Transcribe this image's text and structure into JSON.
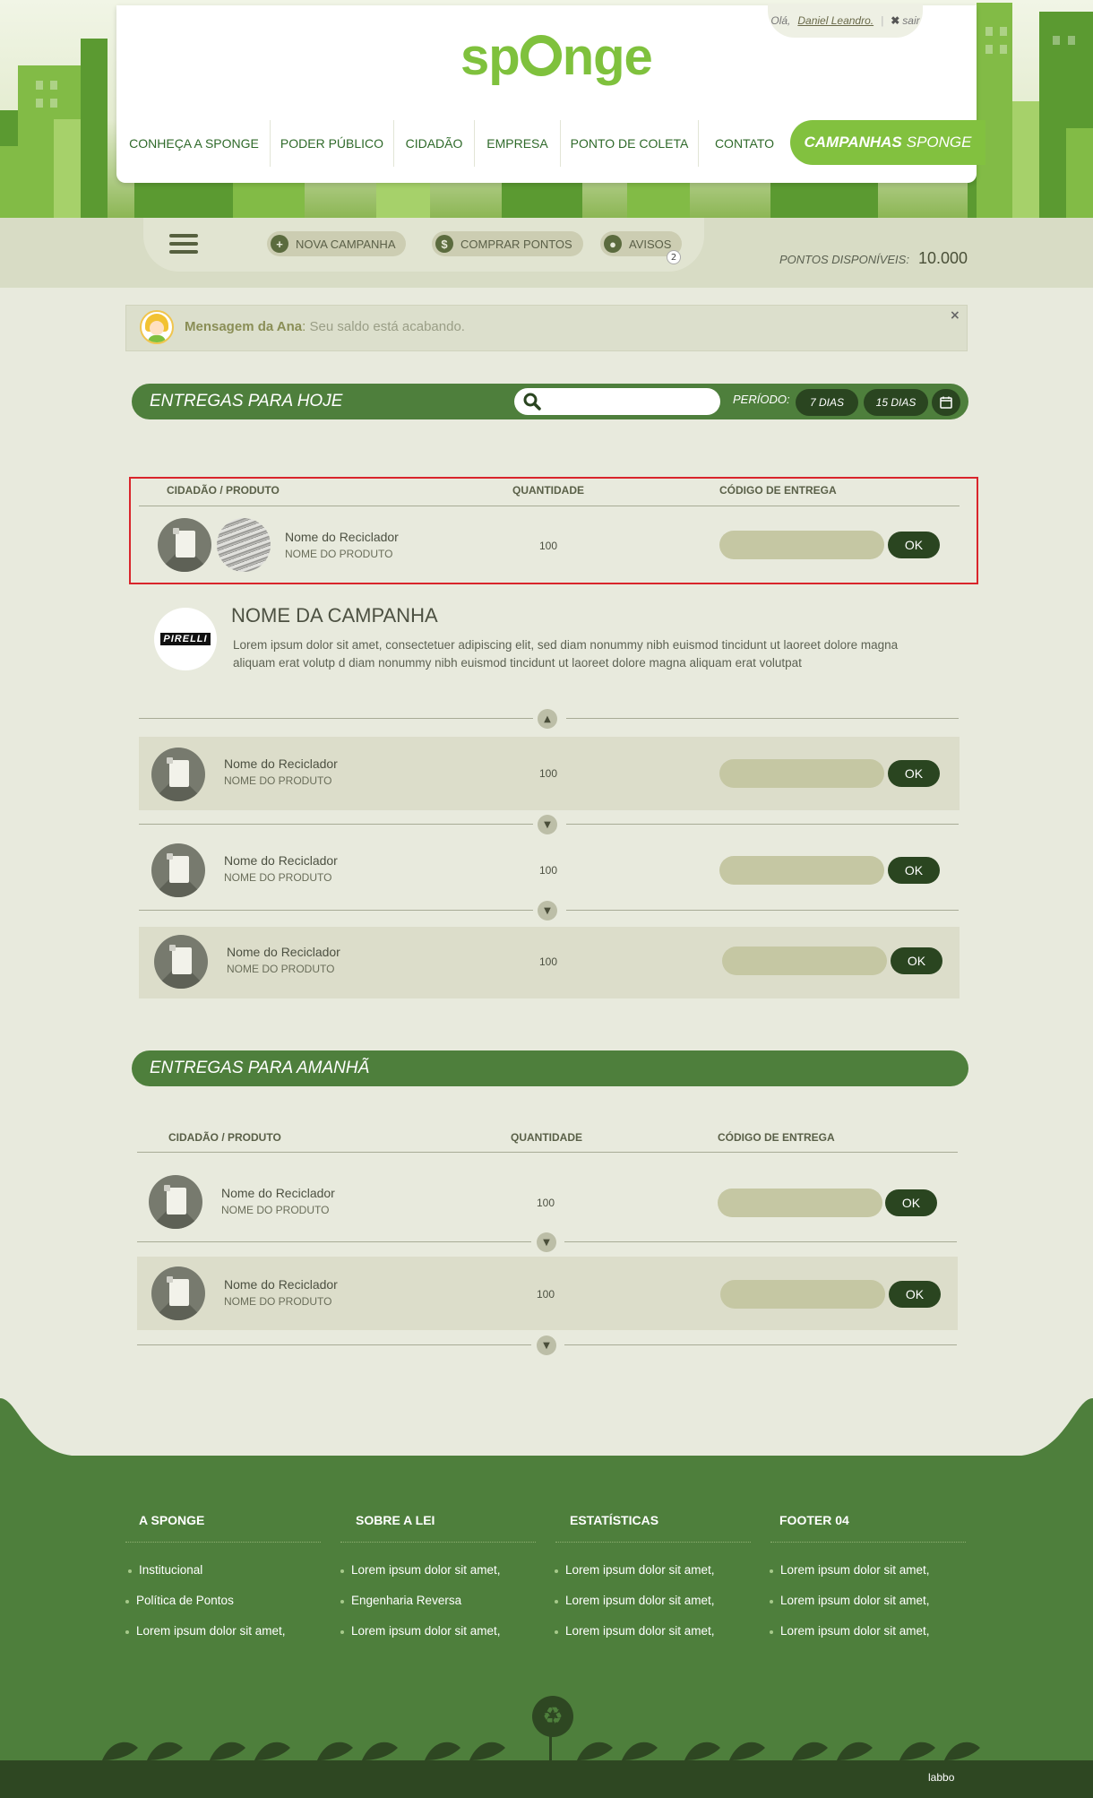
{
  "brand": {
    "name_pre": "sp",
    "name_post": "nge",
    "accent": "#7fc13d",
    "dark": "#2a4520",
    "section": "#4e7f3c"
  },
  "user": {
    "greeting": "Olá,",
    "name": "Daniel Leandro.",
    "sep": "|",
    "logout": "sair"
  },
  "nav": {
    "items": [
      "CONHEÇA A SPONGE",
      "PODER PÚBLICO",
      "CIDADÃO",
      "EMPRESA",
      "PONTO DE COLETA",
      "CONTATO"
    ],
    "campaign_a": "CAMPANHAS",
    "campaign_b": "SPONGE"
  },
  "toolbar": {
    "new_campaign": "NOVA CAMPANHA",
    "buy_points": "COMPRAR PONTOS",
    "notices": "AVISOS",
    "notices_count": "2",
    "points_label": "PONTOS DISPONÍVEIS:",
    "points_value": "10.000"
  },
  "message": {
    "from": "Mensagem da Ana",
    "colon": ":",
    "text": "Seu saldo está acabando.",
    "close": "×"
  },
  "today": {
    "title": "ENTREGAS PARA HOJE",
    "search_placeholder": "",
    "period_label": "PERÍODO:",
    "period_options": [
      "7 DIAS",
      "15 DIAS"
    ]
  },
  "columns": {
    "cidadao": "CIDADÃO / PRODUTO",
    "quantidade": "QUANTIDADE",
    "codigo": "CÓDIGO DE ENTREGA"
  },
  "today_rows": [
    {
      "name": "Nome do Reciclador",
      "product": "NOME DO PRODUTO",
      "qty": "100",
      "ok": "OK"
    }
  ],
  "campaign": {
    "logo": "PIRELLI",
    "name": "NOME DA CAMPANHA",
    "desc": "Lorem ipsum dolor sit amet, consectetuer adipiscing elit, sed diam nonummy nibh euismod tincidunt ut laoreet dolore magna aliquam erat volutp d diam nonummy nibh euismod tincidunt ut laoreet dolore magna aliquam erat volutpat"
  },
  "campaign_rows": [
    {
      "name": "Nome do Reciclador",
      "product": "NOME DO PRODUTO",
      "qty": "100",
      "ok": "OK"
    },
    {
      "name": "Nome do Reciclador",
      "product": "NOME DO PRODUTO",
      "qty": "100",
      "ok": "OK"
    },
    {
      "name": "Nome do Reciclador",
      "product": "NOME DO PRODUTO",
      "qty": "100",
      "ok": "OK"
    }
  ],
  "tomorrow": {
    "title": "ENTREGAS PARA AMANHÃ",
    "columns": {
      "cidadao": "CIDADÃO / PRODUTO",
      "quantidade": "QUANTIDADE",
      "codigo": "CÓDIGO DE ENTREGA"
    }
  },
  "tomorrow_rows": [
    {
      "name": "Nome do Reciclador",
      "product": "NOME DO PRODUTO",
      "qty": "100",
      "ok": "OK"
    },
    {
      "name": "Nome do Reciclador",
      "product": "NOME DO PRODUTO",
      "qty": "100",
      "ok": "OK"
    }
  ],
  "footer": {
    "cols": [
      {
        "title": "A SPONGE",
        "items": [
          "Institucional",
          "Política de Pontos",
          "Lorem ipsum dolor sit amet,"
        ]
      },
      {
        "title": "SOBRE A LEI",
        "items": [
          "Lorem ipsum dolor sit amet,",
          "Engenharia Reversa",
          "Lorem ipsum dolor sit amet,"
        ]
      },
      {
        "title": "ESTATÍSTICAS",
        "items": [
          "Lorem ipsum dolor sit amet,",
          "Lorem ipsum dolor sit amet,",
          "Lorem ipsum dolor sit amet,"
        ]
      },
      {
        "title": "FOOTER 04",
        "items": [
          "Lorem ipsum dolor sit amet,",
          "Lorem ipsum dolor sit amet,",
          "Lorem ipsum dolor sit amet,"
        ]
      }
    ],
    "credit": "labbo"
  }
}
